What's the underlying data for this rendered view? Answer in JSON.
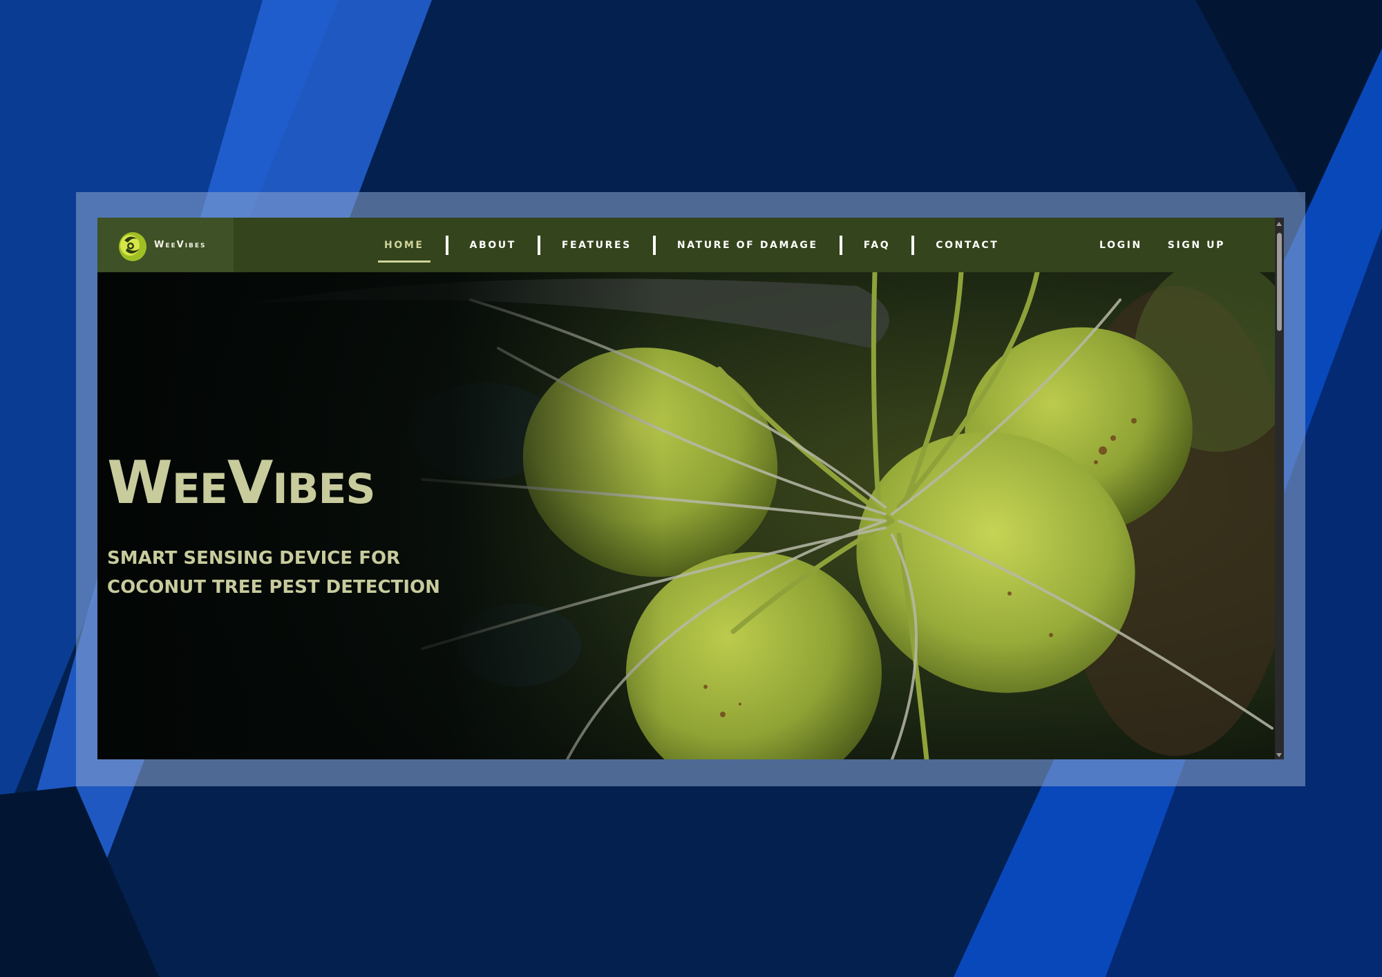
{
  "brand": {
    "name": "WeeVibes",
    "logo_icon": "coconut-logo-icon"
  },
  "nav": {
    "items": [
      {
        "label": "HOME",
        "active": true
      },
      {
        "label": "ABOUT",
        "active": false
      },
      {
        "label": "FEATURES",
        "active": false
      },
      {
        "label": "NATURE OF DAMAGE",
        "active": false
      },
      {
        "label": "FAQ",
        "active": false
      },
      {
        "label": "CONTACT",
        "active": false
      }
    ],
    "login_label": "LOGIN",
    "signup_label": "SIGN UP"
  },
  "hero": {
    "title": "WeeVibes",
    "subtitle": "SMART SENSING DEVICE FOR COCONUT TREE PEST DETECTION",
    "image": "coconut-cluster-photo"
  },
  "colors": {
    "page_background": "#03204e",
    "navbar": "#34441c",
    "brand_block": "#3f5126",
    "accent": "#cdd49b",
    "hero_text": "#c8cb9c"
  }
}
